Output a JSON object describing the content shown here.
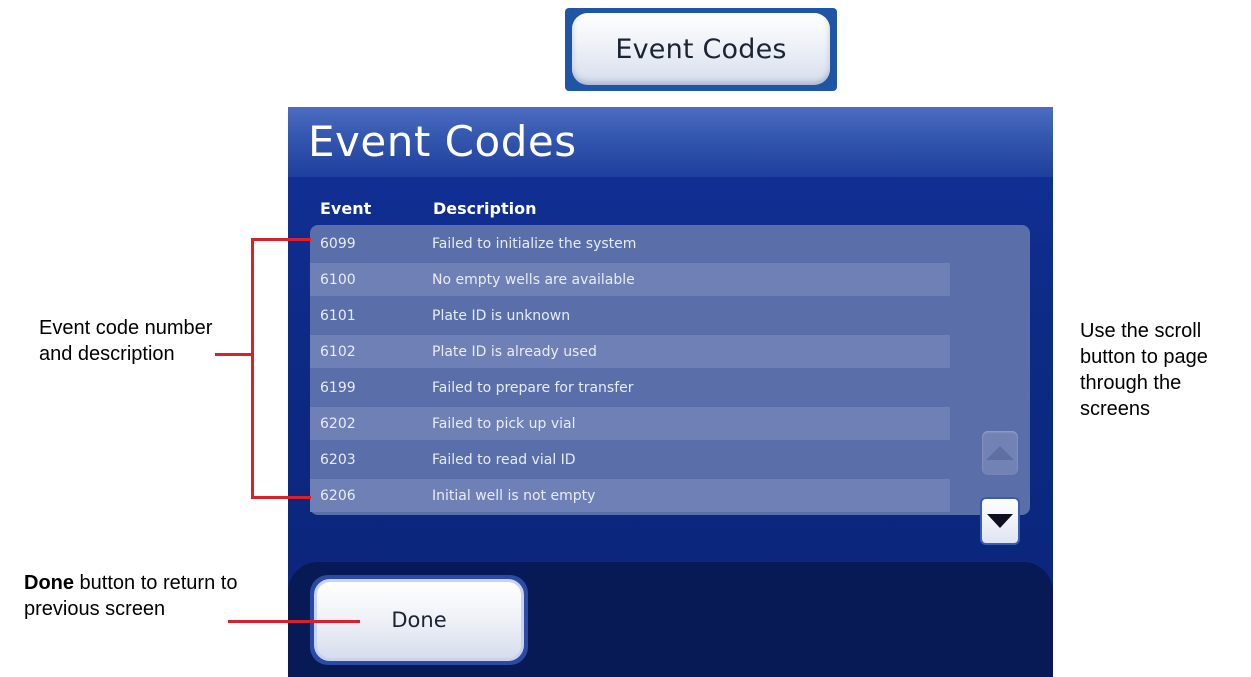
{
  "top_button": {
    "label": "Event Codes"
  },
  "screen": {
    "title": "Event Codes",
    "columns": {
      "event": "Event",
      "description": "Description"
    },
    "rows": [
      {
        "code": "6099",
        "description": "Failed to initialize the system"
      },
      {
        "code": "6100",
        "description": "No empty wells are available"
      },
      {
        "code": "6101",
        "description": "Plate ID is unknown"
      },
      {
        "code": "6102",
        "description": "Plate ID is already used"
      },
      {
        "code": "6199",
        "description": "Failed to prepare for transfer"
      },
      {
        "code": "6202",
        "description": "Failed to pick up vial"
      },
      {
        "code": "6203",
        "description": "Failed to read vial ID"
      },
      {
        "code": "6206",
        "description": "Initial well is not empty"
      }
    ],
    "done_label": "Done"
  },
  "annotations": {
    "left": "Event code number and description",
    "right": "Use the scroll button to page through the screens",
    "done_bold": "Done",
    "done_rest": " button to return to previous screen"
  },
  "icons": {
    "scroll_up": "triangle-up-icon",
    "scroll_down": "triangle-down-icon"
  },
  "colors": {
    "accent_red": "#d9202b",
    "screen_blue": "#0e2a86"
  }
}
